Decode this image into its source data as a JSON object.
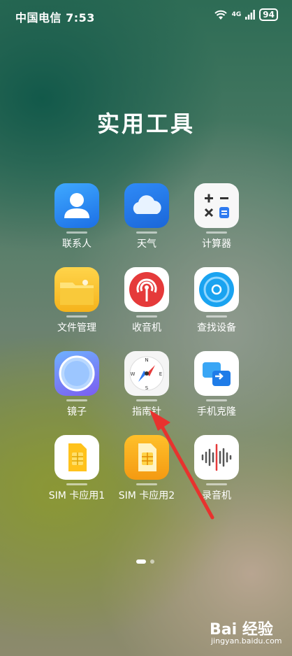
{
  "status_bar": {
    "carrier_time": "中国电信 7:53",
    "network": "4G",
    "battery": "94"
  },
  "folder": {
    "title": "实用工具"
  },
  "apps": [
    {
      "label": "联系人"
    },
    {
      "label": "天气"
    },
    {
      "label": "计算器"
    },
    {
      "label": "文件管理"
    },
    {
      "label": "收音机"
    },
    {
      "label": "查找设备"
    },
    {
      "label": "镜子"
    },
    {
      "label": "指南针"
    },
    {
      "label": "手机克隆"
    },
    {
      "label": "SIM 卡应用1"
    },
    {
      "label": "SIM 卡应用2"
    },
    {
      "label": "录音机"
    }
  ],
  "pagination": {
    "pages": 2,
    "current": 1
  },
  "annotation": {
    "color": "#e8322e"
  },
  "watermark": {
    "logo": "Bai 经验",
    "url": "jingyan.baidu.com"
  }
}
